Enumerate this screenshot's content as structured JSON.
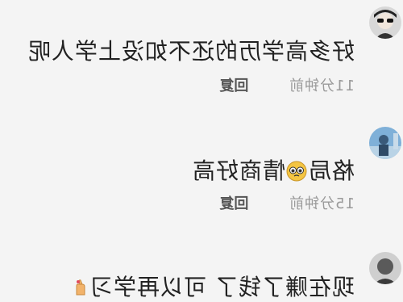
{
  "comments": [
    {
      "text": "好多高学历的还不如没上学人呢",
      "time": "11分钟前",
      "reply_label": "回复",
      "avatar": "sunglasses-person-avatar"
    },
    {
      "text_before": "格局",
      "emoji": "pleading-face-emoji",
      "text_after": "情商好高",
      "time": "15分钟前",
      "reply_label": "回复",
      "avatar": "blue-photo-avatar"
    },
    {
      "text": "现在赚了钱了 可以再学习",
      "emoji": "finger-heart-hand-emoji",
      "avatar": "dark-person-avatar"
    }
  ],
  "colors": {
    "background": "#f4f4f4",
    "text": "#222222",
    "time": "#9a9a9a",
    "reply": "#555555"
  }
}
